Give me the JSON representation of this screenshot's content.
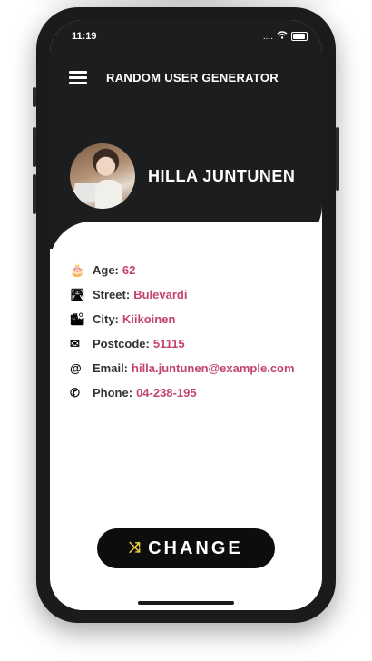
{
  "status_bar": {
    "time": "11:19",
    "signal": "....",
    "wifi_icon": "wifi-icon",
    "battery_icon": "battery-icon"
  },
  "header": {
    "menu_icon": "hamburger-icon",
    "title": "RANDOM USER GENERATOR"
  },
  "profile": {
    "name": "HILLA JUNTUNEN"
  },
  "info": [
    {
      "icon": "birthday-cake-icon",
      "glyph": "🎂",
      "label": "Age:",
      "value": "62"
    },
    {
      "icon": "road-icon",
      "glyph": "🛣",
      "label": "Street:",
      "value": "Bulevardi"
    },
    {
      "icon": "city-icon",
      "glyph": "🏙",
      "label": "City:",
      "value": "Kiikoinen"
    },
    {
      "icon": "mail-icon",
      "glyph": "✉",
      "label": "Postcode:",
      "value": "51115"
    },
    {
      "icon": "at-icon",
      "glyph": "@",
      "label": "Email:",
      "value": "hilla.juntunen@example.com"
    },
    {
      "icon": "phone-icon",
      "glyph": "✆",
      "label": "Phone:",
      "value": "04-238-195"
    }
  ],
  "action": {
    "icon": "shuffle-icon",
    "glyph": "⤨",
    "label": "CHANGE"
  },
  "colors": {
    "dark": "#1c1d1f",
    "accent": "#c2456a",
    "shuffle": "#f2d43f"
  }
}
